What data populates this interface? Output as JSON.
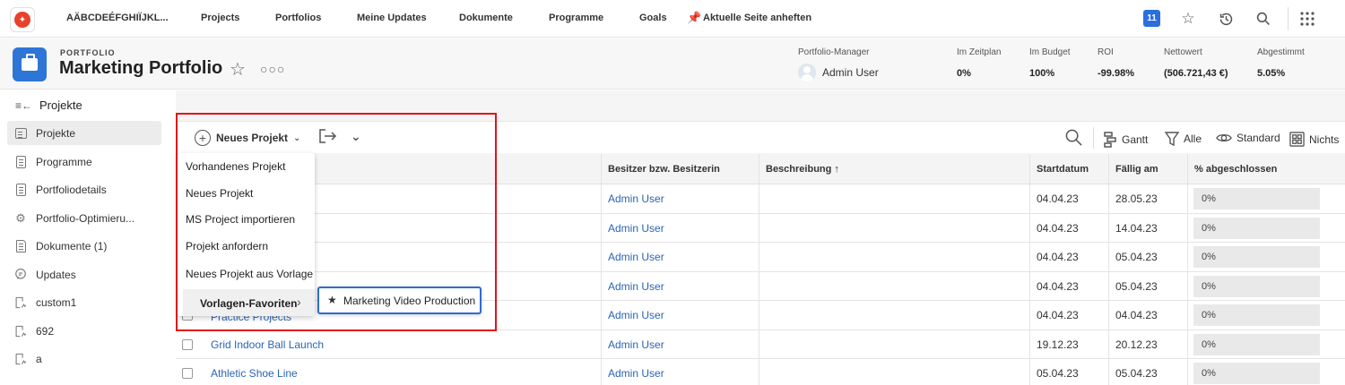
{
  "topnav": {
    "brand": "AÄBCDEÉFGHIÏJKL...",
    "items": [
      "Projects",
      "Portfolios",
      "Meine Updates",
      "Dokumente",
      "Programme",
      "Goals"
    ],
    "pin_label": "Aktuelle Seite anheften",
    "notification_count": "11",
    "icons": [
      "star-icon",
      "history-icon",
      "search-icon",
      "grid-menu-icon"
    ]
  },
  "header": {
    "kicker": "PORTFOLIO",
    "title": "Marketing Portfolio",
    "manager_label": "Portfolio-Manager",
    "manager_name": "Admin User",
    "stats": [
      {
        "label": "Im Zeitplan",
        "value": "0%"
      },
      {
        "label": "Im Budget",
        "value": "100%"
      },
      {
        "label": "ROI",
        "value": "-99.98%"
      },
      {
        "label": "Nettowert",
        "value": "(506.721,43 €)"
      },
      {
        "label": "Abgestimmt",
        "value": "5.05%"
      }
    ]
  },
  "sidebar": {
    "heading": "Projekte",
    "items": [
      {
        "label": "Projekte",
        "icon": "project-icon"
      },
      {
        "label": "Programme",
        "icon": "document-icon"
      },
      {
        "label": "Portfoliodetails",
        "icon": "document-icon"
      },
      {
        "label": "Portfolio-Optimieru...",
        "icon": "optimizer-icon"
      },
      {
        "label": "Dokumente (1)",
        "icon": "file-icon"
      },
      {
        "label": "Updates",
        "icon": "chat-icon"
      },
      {
        "label": "custom1",
        "icon": "custom-form-icon"
      },
      {
        "label": "692",
        "icon": "custom-form-icon"
      },
      {
        "label": "a",
        "icon": "custom-form-icon"
      }
    ]
  },
  "toolbar": {
    "new_project": "Neues Projekt",
    "gantt": "Gantt",
    "filter": "Alle",
    "view": "Standard",
    "grouping": "Nichts"
  },
  "table": {
    "headers": {
      "owner": "Besitzer bzw. Besitzerin",
      "description": "Beschreibung ↑",
      "start": "Startdatum",
      "due": "Fällig am",
      "pct": "% abgeschlossen"
    },
    "rows": [
      {
        "name": "",
        "owner": "Admin User",
        "start": "04.04.23",
        "due": "28.05.23",
        "pct": "0%"
      },
      {
        "name": "",
        "owner": "Admin User",
        "start": "04.04.23",
        "due": "14.04.23",
        "pct": "0%"
      },
      {
        "name": "",
        "owner": "Admin User",
        "start": "04.04.23",
        "due": "05.04.23",
        "pct": "0%"
      },
      {
        "name": "",
        "owner": "Admin User",
        "start": "04.04.23",
        "due": "05.04.23",
        "pct": "0%"
      },
      {
        "name": "Practice Projects",
        "owner": "Admin User",
        "start": "04.04.23",
        "due": "04.04.23",
        "pct": "0%"
      },
      {
        "name": "Grid Indoor Ball Launch",
        "owner": "Admin User",
        "start": "19.12.23",
        "due": "20.12.23",
        "pct": "0%"
      },
      {
        "name": "Athletic Shoe Line",
        "owner": "Admin User",
        "start": "05.04.23",
        "due": "05.04.23",
        "pct": "0%"
      }
    ]
  },
  "menu": {
    "items": [
      "Vorhandenes Projekt",
      "Neues Projekt",
      "MS Project importieren",
      "Projekt anfordern",
      "Neues Projekt aus Vorlage"
    ],
    "submenu_label": "Vorlagen-Favoriten",
    "submenu_item": "Marketing Video Production"
  },
  "colors": {
    "accent": "#2b6fe0",
    "link": "#2b64b6",
    "highlight_box": "#e0141b",
    "logo": "#e8412e"
  }
}
